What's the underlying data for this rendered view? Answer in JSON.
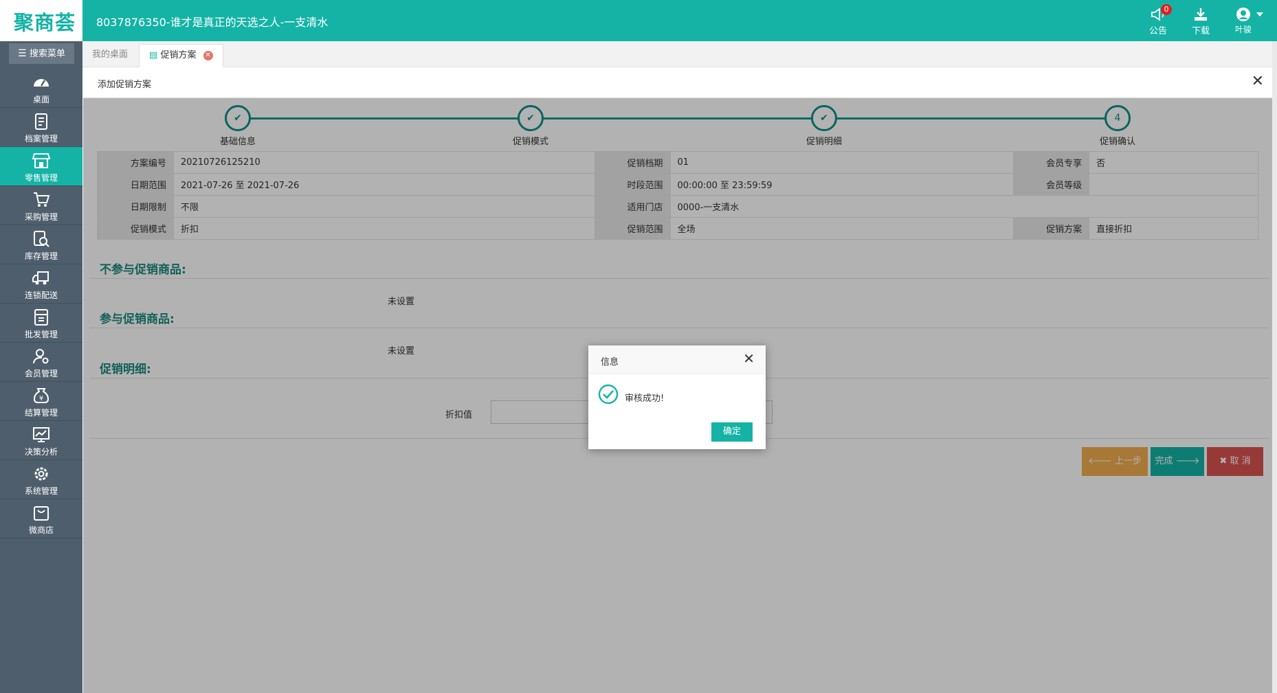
{
  "header": {
    "logo": "聚商荟",
    "title": "8037876350-谁才是真正的天选之人-一支清水",
    "notice_label": "公告",
    "notice_count": "0",
    "download_label": "下载",
    "user_name": "叶骏"
  },
  "sidebar": {
    "search_label": "搜索菜单",
    "items": [
      {
        "label": "桌面",
        "icon": "dashboard-icon"
      },
      {
        "label": "档案管理",
        "icon": "archive-icon"
      },
      {
        "label": "零售管理",
        "icon": "store-icon"
      },
      {
        "label": "采购管理",
        "icon": "cart-icon"
      },
      {
        "label": "库存管理",
        "icon": "inventory-search-icon"
      },
      {
        "label": "连锁配送",
        "icon": "truck-icon"
      },
      {
        "label": "批发管理",
        "icon": "wholesale-icon"
      },
      {
        "label": "会员管理",
        "icon": "member-icon"
      },
      {
        "label": "结算管理",
        "icon": "yen-bag-icon"
      },
      {
        "label": "决策分析",
        "icon": "chart-board-icon"
      },
      {
        "label": "系统管理",
        "icon": "gear-icon"
      },
      {
        "label": "微商店",
        "icon": "shopping-bag-icon"
      }
    ],
    "active_index": 2
  },
  "tabs": {
    "home": "我的桌面",
    "current": "促销方案"
  },
  "panel": {
    "title": "添加促销方案"
  },
  "steps": [
    {
      "label": "基础信息",
      "state": "done"
    },
    {
      "label": "促销模式",
      "state": "done"
    },
    {
      "label": "促销明细",
      "state": "done"
    },
    {
      "label": "促销确认",
      "state": "current",
      "number": "4"
    }
  ],
  "info": {
    "scheme_no_label": "方案编号",
    "scheme_no": "20210726125210",
    "period_label": "促销档期",
    "period": "01",
    "member_only_label": "会员专享",
    "member_only": "否",
    "date_range_label": "日期范围",
    "date_range": "2021-07-26 至 2021-07-26",
    "time_range_label": "时段范围",
    "time_range": "00:00:00 至 23:59:59",
    "member_level_label": "会员等级",
    "member_level": "",
    "date_limit_label": "日期限制",
    "date_limit": "不限",
    "store_label": "适用门店",
    "store": "0000-一支清水",
    "mode_label": "促销模式",
    "mode": "折扣",
    "scope_label": "促销范围",
    "scope": "全场",
    "scheme_label": "促销方案",
    "scheme": "直接折扣"
  },
  "sections": {
    "excluded_title": "不参与促销商品:",
    "excluded_value": "未设置",
    "included_title": "参与促销商品:",
    "included_value": "未设置",
    "detail_title": "促销明细:",
    "discount_label": "折扣值",
    "discount_value": ""
  },
  "buttons": {
    "prev": "上一步",
    "done": "完成",
    "cancel": "取 消"
  },
  "modal": {
    "title": "信息",
    "message": "审核成功!",
    "ok": "确定"
  },
  "colors": {
    "brand": "#14b3a6",
    "sidebar": "#4f5e6d",
    "step": "#0c8f87",
    "warning": "#f0ad4e",
    "danger": "#d9534f"
  }
}
